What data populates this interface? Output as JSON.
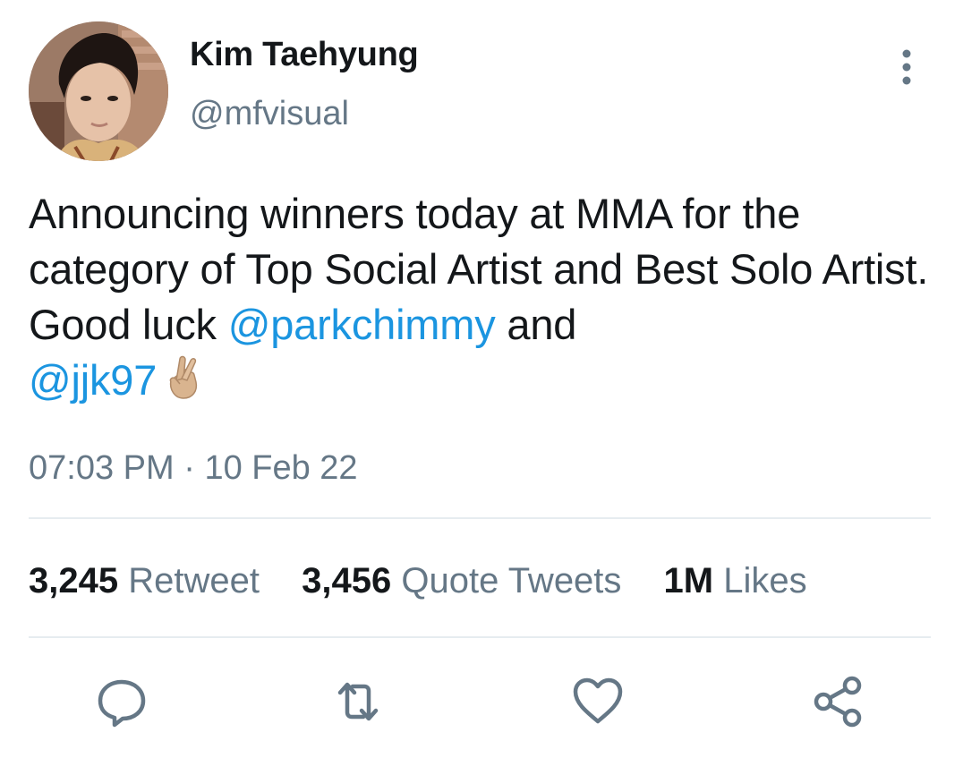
{
  "author": {
    "display_name": "Kim Taehyung",
    "handle": "@mfvisual"
  },
  "tweet": {
    "text_1": "Announcing winners today at MMA  for the category of Top Social Artist and Best Solo Artist. Good luck ",
    "mention_1": "@parkchimmy",
    "text_2": " and ",
    "mention_2": "@jjk97",
    "emoji": "crossed-fingers-emoji"
  },
  "meta": {
    "time": "07:03 PM",
    "separator": "·",
    "date": "10 Feb 22"
  },
  "stats": {
    "retweets": {
      "count": "3,245",
      "label": "Retweet"
    },
    "quotes": {
      "count": "3,456",
      "label": "Quote Tweets"
    },
    "likes": {
      "count": "1M",
      "label": "Likes"
    }
  },
  "actions": {
    "reply": "reply-icon",
    "retweet": "retweet-icon",
    "like": "heart-icon",
    "share": "share-icon"
  },
  "colors": {
    "text": "#14171a",
    "secondary": "#657786",
    "link": "#1b95e0",
    "divider": "#e6ecf0"
  }
}
